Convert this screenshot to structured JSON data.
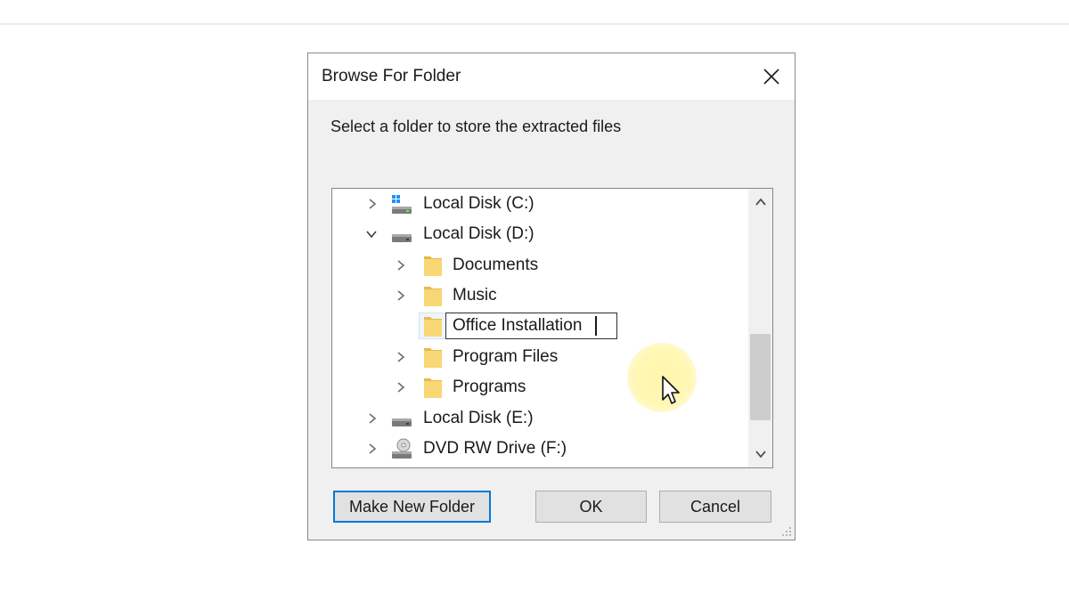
{
  "dialog": {
    "title": "Browse For Folder",
    "instruction": "Select a folder to store the extracted files"
  },
  "tree": {
    "items": [
      {
        "label": "Local Disk (C:)",
        "icon": "windows-drive-icon",
        "expanded": false
      },
      {
        "label": "Local Disk (D:)",
        "icon": "drive-icon",
        "expanded": true
      },
      {
        "label": "Documents",
        "icon": "folder-icon",
        "expanded": false
      },
      {
        "label": "Music",
        "icon": "folder-icon",
        "expanded": false
      },
      {
        "label": "Office Installation",
        "icon": "folder-icon",
        "editing": true
      },
      {
        "label": "Program Files",
        "icon": "folder-icon",
        "expanded": false
      },
      {
        "label": "Programs",
        "icon": "folder-icon",
        "expanded": false
      },
      {
        "label": "Local Disk (E:)",
        "icon": "drive-icon",
        "expanded": false
      },
      {
        "label": "DVD RW Drive (F:)",
        "icon": "dvd-drive-icon",
        "expanded": false
      }
    ],
    "rename_value": "Office Installation"
  },
  "buttons": {
    "make_new_folder": "Make New Folder",
    "ok": "OK",
    "cancel": "Cancel"
  },
  "colors": {
    "folder": "#f8d775",
    "folder_dark": "#e6b94a",
    "focus_border": "#0078d7",
    "dialog_bg": "#f0f0f0"
  }
}
